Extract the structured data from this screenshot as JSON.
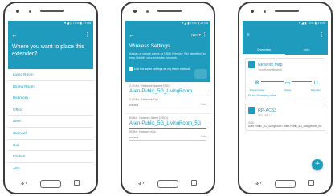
{
  "colors": {
    "accent": "#1e9bbd"
  },
  "status_text": "▼◢ ▮ 71% ▮ 17:05",
  "screen1": {
    "title": "Where you want to place this extender?",
    "locations": [
      "Living Room",
      "Dining Room",
      "Bedroom",
      "Office",
      "Aisle",
      "Stairwell",
      "Hall",
      "Kitchen",
      "Attic"
    ]
  },
  "screen2": {
    "next_label": "NEXT",
    "title": "Wireless Settings",
    "description": "Assign a unique name or SSID (Service Set Identifier) to help identify your extender network.",
    "checkbox_label": "Use the same settings as my home network",
    "bands": [
      {
        "band_label": "2.4GHz · Network Name (SSID)",
        "ssid": "Alien-Public_5G_LivingRoom",
        "key_label": "2.4GHz · Network Key",
        "password": "••••••••",
        "eye": "Hide"
      },
      {
        "band_label": "5GHz · Network Name (SSID)",
        "ssid": "Alien-Public_5G_LivingRoom_5G",
        "key_label": "5GHz · Network Key",
        "password": "••••••••",
        "eye": "Hide"
      }
    ]
  },
  "screen3": {
    "tabs": [
      "Overview",
      "Map"
    ],
    "network_map_title": "Network Map",
    "network_map_sub": "Your Home Network",
    "nodes": [
      {
        "icon": "globe-icon",
        "glyph": "⊕",
        "label": "Disconnected"
      },
      {
        "icon": "router-icon",
        "glyph": "▭",
        "label": "Router"
      },
      {
        "icon": "extender-icon",
        "glyph": "⊔",
        "label": "Extender"
      }
    ],
    "card_link": "Fix the Something to fine",
    "device_name": "RP-AC53",
    "device_ip": "192.168.1.1",
    "ssid_label": "SSID",
    "ssid_value": "Alien-Public_5G_LivingRoom / Alien-Public_5G_LivingRoom_5G",
    "fab_label": "+"
  }
}
